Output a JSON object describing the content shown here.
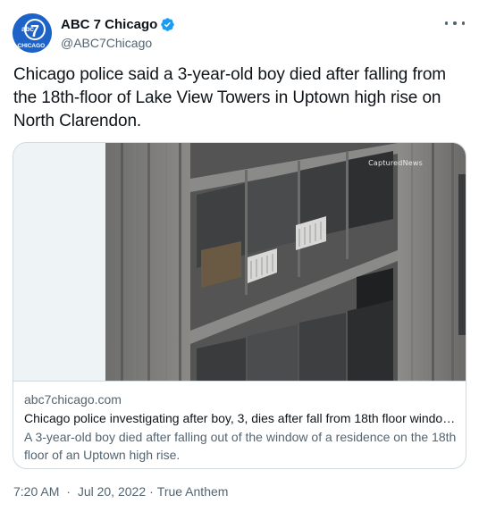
{
  "author": {
    "name": "ABC 7 Chicago",
    "handle": "@ABC7Chicago",
    "avatar_text_top": "abc",
    "avatar_number": "7",
    "avatar_text_bottom": "CHICAGO",
    "verified": true,
    "verified_color": "#1d9bf0",
    "avatar_color": "#1d63c7"
  },
  "tweet": {
    "text": "Chicago police said a 3-year-old boy died after falling from the 18th-floor of Lake View Towers in Uptown high rise on North Clarendon."
  },
  "card": {
    "image_watermark": "CapturedNews",
    "domain": "abc7chicago.com",
    "title": "Chicago police investigating after boy, 3, dies after fall from 18th floor window i...",
    "description": "A 3-year-old boy died after falling out of the window of a residence on the 18th floor of an Uptown high rise."
  },
  "meta": {
    "time": "7:20 AM",
    "separator": "·",
    "date": "Jul 20, 2022",
    "source": "True Anthem"
  },
  "icons": {
    "more": "more-dots-icon",
    "verified": "verified-badge-icon"
  }
}
